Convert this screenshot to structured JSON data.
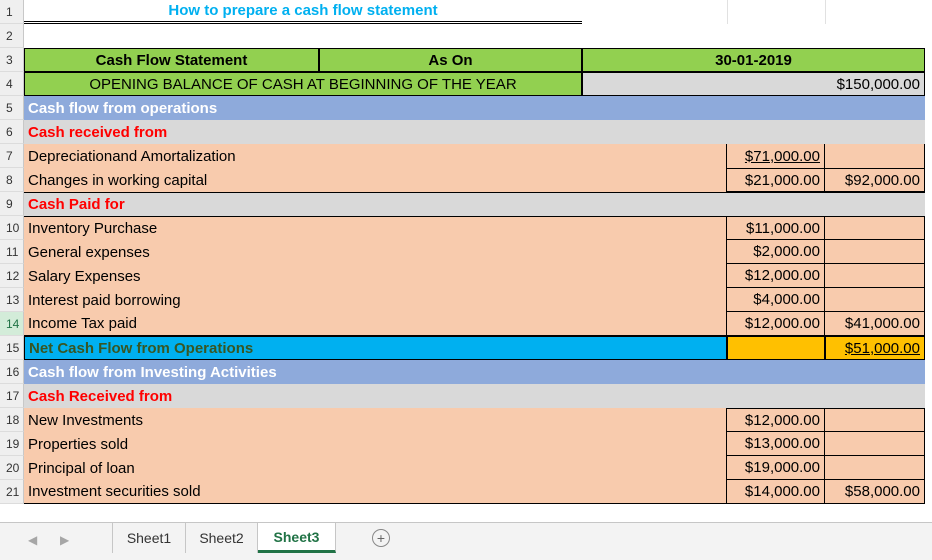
{
  "sheet": {
    "title": "How to prepare a cash flow statement",
    "row_numbers": [
      "1",
      "2",
      "3",
      "4",
      "5",
      "6",
      "7",
      "8",
      "9",
      "10",
      "11",
      "12",
      "13",
      "14",
      "15",
      "16",
      "17",
      "18",
      "19",
      "20",
      "21"
    ],
    "header": {
      "col_a": "Cash Flow Statement",
      "col_b": "As On",
      "col_cd": "30-01-2019"
    },
    "opening": {
      "label": "OPENING BALANCE OF CASH AT BEGINNING OF THE YEAR",
      "value": "$150,000.00"
    },
    "operations": {
      "section_label": "Cash flow from operations",
      "received_label": "Cash received from",
      "received_items": [
        {
          "label": "Depreciationand Amortalization",
          "amount": "$71,000.00",
          "total": ""
        },
        {
          "label": "Changes in working capital",
          "amount": "$21,000.00",
          "total": "$92,000.00"
        }
      ],
      "paid_label": "Cash Paid for",
      "paid_items": [
        {
          "label": "Inventory Purchase",
          "amount": "$11,000.00",
          "total": ""
        },
        {
          "label": "General expenses",
          "amount": "$2,000.00",
          "total": ""
        },
        {
          "label": "Salary Expenses",
          "amount": "$12,000.00",
          "total": ""
        },
        {
          "label": "Interest paid borrowing",
          "amount": "$4,000.00",
          "total": ""
        },
        {
          "label": "Income Tax paid",
          "amount": "$12,000.00",
          "total": "$41,000.00"
        }
      ],
      "net_label": "Net Cash Flow from Operations",
      "net_value": "$51,000.00"
    },
    "investing": {
      "section_label": "Cash flow from Investing Activities",
      "received_label": "Cash Received from",
      "received_items": [
        {
          "label": "New Investments",
          "amount": "$12,000.00",
          "total": ""
        },
        {
          "label": "Properties sold",
          "amount": "$13,000.00",
          "total": ""
        },
        {
          "label": "Principal of loan",
          "amount": "$19,000.00",
          "total": ""
        },
        {
          "label": "Investment securities sold",
          "amount": "$14,000.00",
          "total": "$58,000.00"
        }
      ]
    }
  },
  "tabs": {
    "prev_icon": "◀",
    "next_icon": "▶",
    "items": [
      "Sheet1",
      "Sheet2",
      "Sheet3"
    ],
    "active": "Sheet3",
    "add_icon": "+"
  },
  "colors": {
    "green_header": "#92d050",
    "section_blue": "#8eaadb",
    "peach": "#f8cbad",
    "net_cyan": "#00b0f0",
    "net_orange": "#ffc000",
    "accent_green": "#217346"
  }
}
